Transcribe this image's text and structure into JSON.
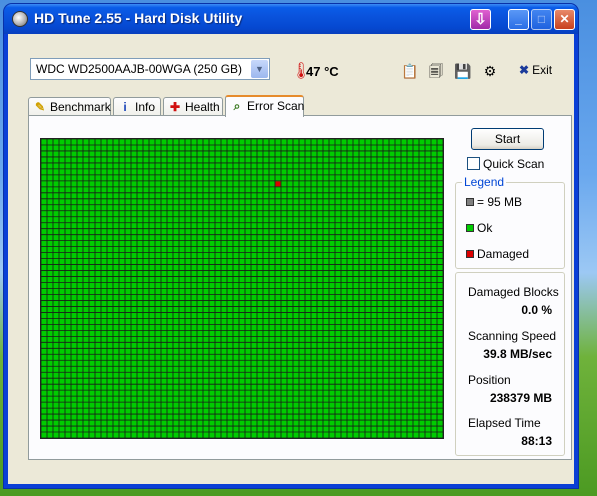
{
  "window": {
    "title": "HD Tune 2.55 - Hard Disk Utility"
  },
  "toolbar": {
    "drive": "WDC WD2500AAJB-00WGA (250 GB)",
    "temperature": "47 °C",
    "exit_label": "Exit"
  },
  "tabs": [
    {
      "label": "Benchmark",
      "icon": "lightbulb-icon"
    },
    {
      "label": "Info",
      "icon": "info-icon"
    },
    {
      "label": "Health",
      "icon": "health-cross-icon"
    },
    {
      "label": "Error Scan",
      "icon": "magnifier-icon",
      "active": true
    }
  ],
  "scan": {
    "start_label": "Start",
    "quick_scan_label": "Quick Scan",
    "quick_scan_checked": false,
    "damaged_block": {
      "row": 7,
      "col": 39
    }
  },
  "legend": {
    "title": "Legend",
    "items": [
      {
        "label": "= 95 MB",
        "color": "#808080"
      },
      {
        "label": "Ok",
        "color": "#00cc00"
      },
      {
        "label": "Damaged",
        "color": "#dd0000"
      }
    ]
  },
  "stats": {
    "damaged_blocks_label": "Damaged Blocks",
    "damaged_blocks_value": "0.0 %",
    "scanning_speed_label": "Scanning Speed",
    "scanning_speed_value": "39.8 MB/sec",
    "position_label": "Position",
    "position_value": "238379 MB",
    "elapsed_label": "Elapsed Time",
    "elapsed_value": "88:13"
  },
  "colors": {
    "ok": "#00cc00",
    "damaged": "#dd0000",
    "grid_line": "#1a1a1a"
  }
}
